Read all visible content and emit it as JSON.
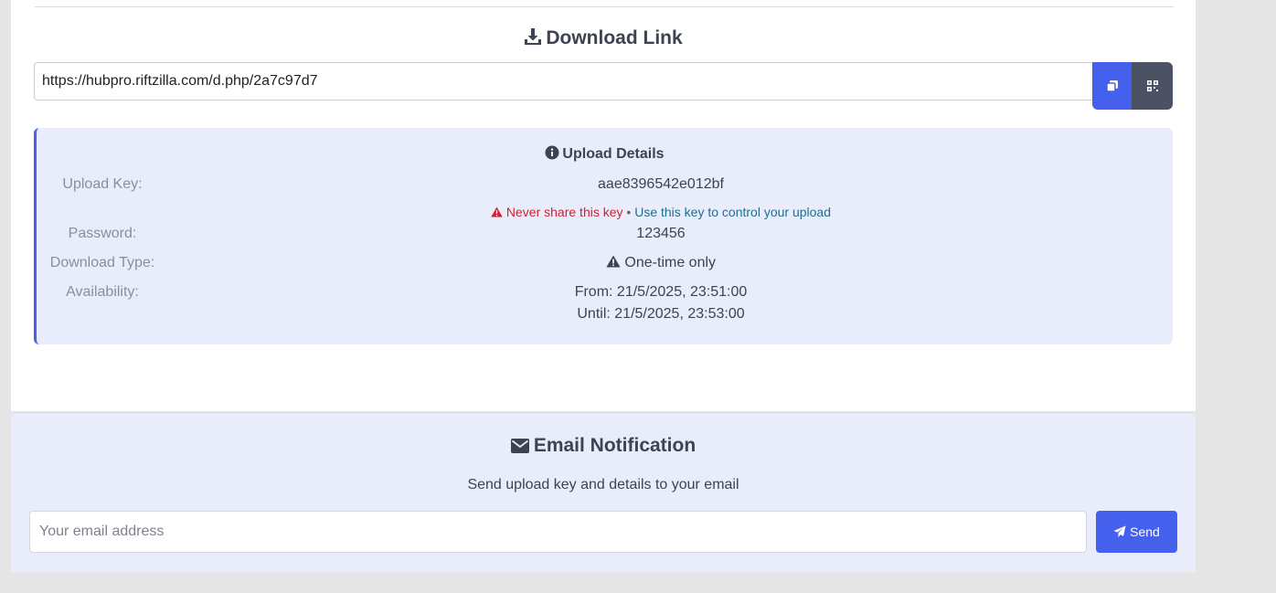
{
  "download": {
    "title": "Download Link",
    "url": "https://hubpro.riftzilla.com/d.php/2a7c97d7",
    "copy_icon": "copy-icon",
    "qr_icon": "qr-icon"
  },
  "details": {
    "title": "Upload Details",
    "upload_key_label": "Upload Key:",
    "upload_key_value": "aae8396542e012bf",
    "warning_text": "Never share this key",
    "warning_separator": "•",
    "info_text": "Use this key to control your upload",
    "password_label": "Password:",
    "password_value": "123456",
    "download_type_label": "Download Type:",
    "download_type_value": "One-time only",
    "availability_label": "Availability:",
    "availability_from": "From: 21/5/2025, 23:51:00",
    "availability_until": "Until: 21/5/2025, 23:53:00"
  },
  "email": {
    "title": "Email Notification",
    "subtitle": "Send upload key and details to your email",
    "placeholder": "Your email address",
    "send_label": "Send"
  },
  "colors": {
    "accent": "#4660ee",
    "secondary_button": "#4a5263",
    "panel_bg": "#e9edfb",
    "warning": "#d11f2e",
    "info": "#1f6f90"
  }
}
